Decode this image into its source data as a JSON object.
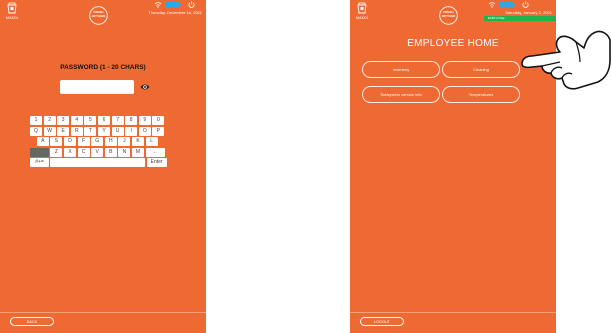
{
  "left_screen": {
    "machine_label": "MAKDI",
    "logo_text": "FRESH OPTIONS",
    "date": "Thursday, December 16, 2021",
    "password_title": "PASSWORD (1 - 20 CHARS)",
    "password_value": "",
    "keyboard": {
      "row1": [
        "1",
        "2",
        "3",
        "4",
        "5",
        "6",
        "7",
        "8",
        "9",
        "0"
      ],
      "row2": [
        "Q",
        "W",
        "E",
        "R",
        "T",
        "Y",
        "U",
        "I",
        "O",
        "P"
      ],
      "row3": [
        "A",
        "S",
        "D",
        "F",
        "G",
        "H",
        "J",
        "K",
        "L"
      ],
      "row4": [
        "Z",
        "X",
        "C",
        "V",
        "B",
        "N",
        "M",
        "←"
      ],
      "symbols_key": "#+=",
      "enter_key": "Enter"
    },
    "back_label": "BACK"
  },
  "right_screen": {
    "machine_label": "MAKDI",
    "logo_text": "FRESH OPTIONS",
    "date": "Saturday, January 2, 2021",
    "role": "EMPLOYEE",
    "title": "EMPLOYEE HOME",
    "buttons": [
      "Inventory",
      "Cleaning",
      "Subsystem version info",
      "Temperatures"
    ],
    "logout_label": "LOGOUT"
  },
  "colors": {
    "screen_bg": "#ef6a33",
    "badge_green": "#22b14c",
    "shift_key": "#666666"
  },
  "icons": [
    "machine-icon",
    "logo-icon",
    "wifi-icon",
    "battery-icon",
    "power-icon",
    "eye-icon",
    "pointing-hand-icon"
  ]
}
